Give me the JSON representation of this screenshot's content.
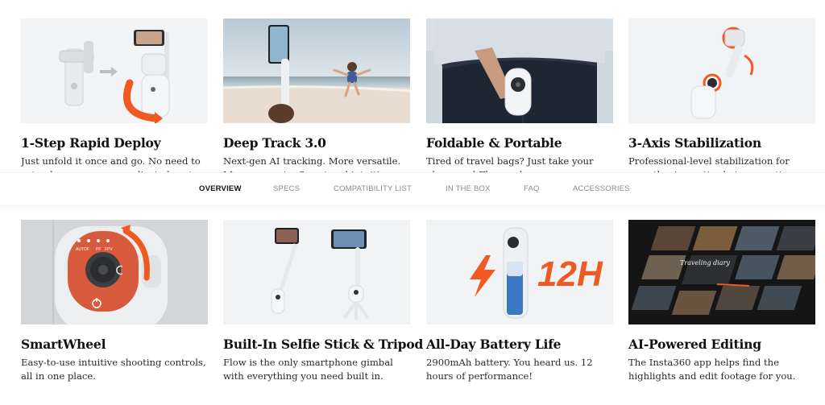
{
  "cards": [
    {
      "title": "1-Step Rapid Deploy",
      "desc": "Just unfold it once and go. No need to extend or unscrew complicated parts.",
      "image": "gimbal-unfold-illustration"
    },
    {
      "title": "Deep Track 3.0",
      "desc": "Next-gen AI tracking. More versatile. More accurate. Smart and intuitive.",
      "image": "beach-tracking-photo"
    },
    {
      "title": "Foldable & Portable",
      "desc": "Tired of travel bags? Just take your phone and Flow and go.",
      "image": "pocket-gimbal-photo"
    },
    {
      "title": "3-Axis Stabilization",
      "desc": "Professional-level stabilization for smooth, cinematic shots every time.",
      "image": "stabilizer-illustration"
    },
    {
      "title": "SmartWheel",
      "desc": "Easy-to-use intuitive shooting controls, all in one place.",
      "image": "smartwheel-closeup"
    },
    {
      "title": "Built-In Selfie Stick & Tripod",
      "desc": "Flow is the only smartphone gimbal with everything you need built in.",
      "image": "selfie-stick-tripod-illustration"
    },
    {
      "title": "All-Day Battery Life",
      "desc": "2900mAh battery. You heard us. 12 hours of performance!",
      "image": "battery-illustration",
      "badge": "12H"
    },
    {
      "title": "AI-Powered Editing",
      "desc": "The Insta360 app helps find the highlights and edit footage for you.",
      "image": "ai-editing-screens",
      "overlay_text": "Traveling diary"
    }
  ],
  "tabs": [
    {
      "label": "OVERVIEW",
      "active": true
    },
    {
      "label": "SPECS",
      "active": false
    },
    {
      "label": "COMPATIBILITY LIST",
      "active": false
    },
    {
      "label": "IN THE BOX",
      "active": false
    },
    {
      "label": "FAQ",
      "active": false
    },
    {
      "label": "ACCESSORIES",
      "active": false
    }
  ],
  "smartwheel_modes": [
    "AUTO",
    "F",
    "PF",
    "FPV"
  ],
  "colors": {
    "accent_orange": "#f05a22",
    "text": "#1a1a1a",
    "tab_inactive": "#8a8a8a"
  }
}
